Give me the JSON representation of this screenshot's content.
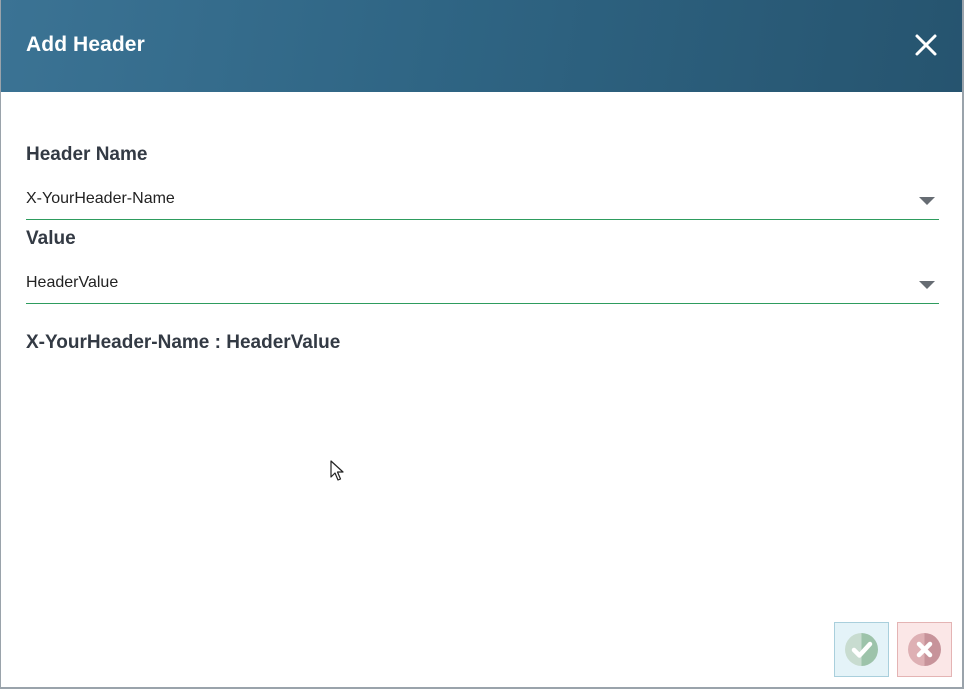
{
  "dialog": {
    "title": "Add Header",
    "close_icon": "close-icon"
  },
  "header_name": {
    "label": "Header Name",
    "value": "X-YourHeader-Name"
  },
  "value_field": {
    "label": "Value",
    "value": "HeaderValue"
  },
  "preview": {
    "name": "X-YourHeader-Name",
    "separator": " : ",
    "value": "HeaderValue"
  },
  "actions": {
    "ok_icon": "checkmark-icon",
    "cancel_icon": "cancel-x-icon"
  },
  "colors": {
    "title_bar": "#2f6584",
    "field_underline": "#2e9c5e",
    "ok_bg": "#e4f3f8",
    "cancel_bg": "#fbe7e7"
  }
}
